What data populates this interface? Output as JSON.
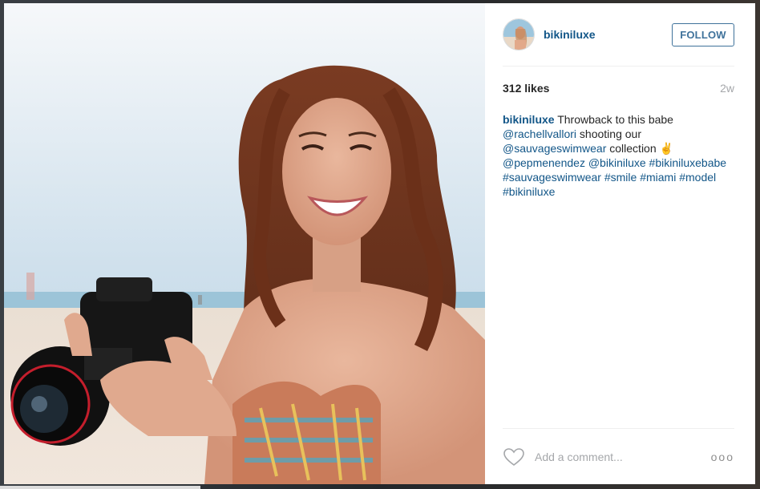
{
  "post": {
    "username": "bikiniluxe",
    "follow_label": "FOLLOW",
    "likes": "312 likes",
    "age": "2w",
    "caption": {
      "author": "bikiniluxe",
      "t1": " Throwback to this babe ",
      "m1": "@rachellvallori",
      "t2": " shooting our ",
      "m2": "@sauvageswimwear",
      "t3": " collection ✌ ",
      "m3": "@pepmenendez",
      "t4": " ",
      "m4": "@bikiniluxe",
      "t5": " ",
      "h1": "#bikiniluxebabe",
      "t6": " ",
      "h2": "#sauvageswimwear",
      "t7": " ",
      "h3": "#smile",
      "t8": " ",
      "h4": "#miami",
      "t9": " ",
      "h5": "#model",
      "t10": " ",
      "h6": "#bikiniluxe"
    },
    "comment_placeholder": "Add a comment...",
    "more_label": "ooo"
  },
  "colors": {
    "link": "#125688",
    "follow_border": "#3f729b",
    "muted": "#a5a7aa"
  },
  "icons": {
    "like": "heart-outline-icon",
    "more": "ellipsis-icon"
  }
}
